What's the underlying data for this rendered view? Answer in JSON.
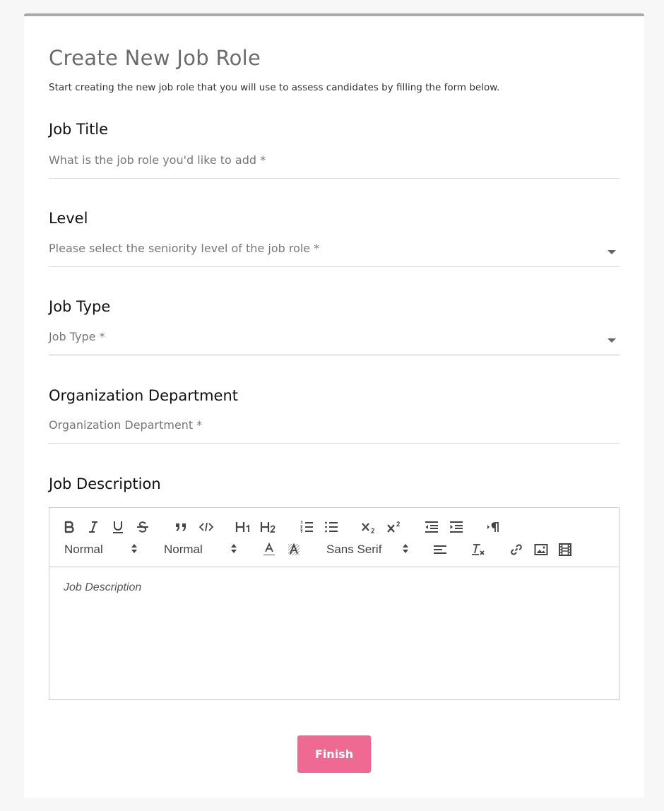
{
  "form": {
    "title": "Create New Job Role",
    "subtitle": "Start creating the new job role that you will use to assess candidates by filling the form below.",
    "fields": {
      "job_title": {
        "heading": "Job Title",
        "placeholder": "What is the job role you'd like to add  *"
      },
      "level": {
        "heading": "Level",
        "placeholder": "Please select the seniority level of the job role  *"
      },
      "job_type": {
        "heading": "Job Type",
        "placeholder": "Job Type *"
      },
      "department": {
        "heading": "Organization Department",
        "placeholder": "Organization Department *"
      },
      "description": {
        "heading": "Job Description",
        "placeholder": "Job Description"
      }
    },
    "toolbar": {
      "header_picker": "Normal",
      "size_picker": "Normal",
      "font_picker": "Sans Serif",
      "icons": [
        "bold-icon",
        "italic-icon",
        "underline-icon",
        "strike-icon",
        "blockquote-icon",
        "code-block-icon",
        "header-1-icon",
        "header-2-icon",
        "ordered-list-icon",
        "bullet-list-icon",
        "subscript-icon",
        "superscript-icon",
        "outdent-icon",
        "indent-icon",
        "text-direction-icon",
        "text-color-icon",
        "background-color-icon",
        "align-icon",
        "clear-format-icon",
        "link-icon",
        "image-icon",
        "video-icon"
      ]
    },
    "finish_label": "Finish"
  },
  "colors": {
    "accent": "#ee6a93",
    "card_border": "#aaaaaa",
    "title": "#6b6b6b"
  }
}
